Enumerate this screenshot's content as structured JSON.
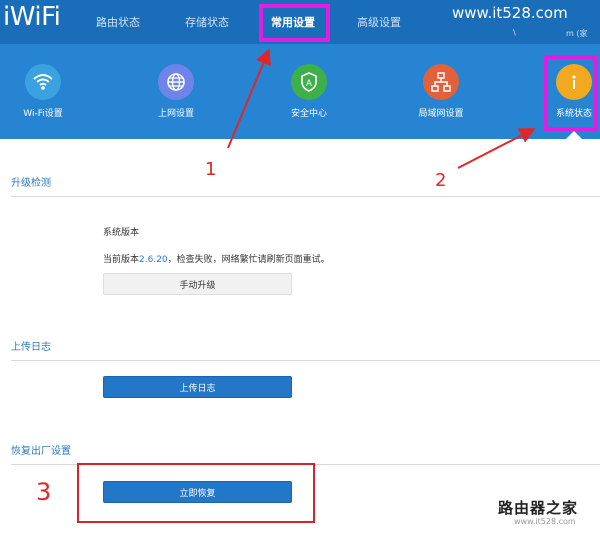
{
  "header": {
    "logo": "iWiFi",
    "tabs": [
      {
        "label": "路由状态"
      },
      {
        "label": "存储状态"
      },
      {
        "label": "常用设置"
      },
      {
        "label": "高级设置"
      }
    ],
    "watermark": "www.it528.com",
    "tiny_left": "\\",
    "tiny_right": "m (家"
  },
  "icons": [
    {
      "label": "Wi-Fi设置",
      "icon": "wifi-icon",
      "color": "#3aa2e0"
    },
    {
      "label": "上网设置",
      "icon": "globe-icon",
      "color": "#6e84e8"
    },
    {
      "label": "安全中心",
      "icon": "shield-icon",
      "color": "#3db04a"
    },
    {
      "label": "局域网设置",
      "icon": "network-icon",
      "color": "#e2613a"
    },
    {
      "label": "系统状态",
      "icon": "info-icon",
      "color": "#f2a91f"
    }
  ],
  "upgrade": {
    "title": "升级检测",
    "version_heading": "系统版本",
    "status_prefix": "当前版本",
    "version": "2.6.20",
    "status_suffix": "，检查失败，网络繁忙请刷新页面重试。",
    "button": "手动升级"
  },
  "log": {
    "title": "上传日志",
    "button": "上传日志"
  },
  "reset": {
    "title": "恢复出厂设置",
    "button": "立即恢复"
  },
  "annotations": {
    "n1": "1",
    "n2": "2",
    "n3": "3"
  },
  "corner_watermark": {
    "main": "路由器之家",
    "sub": "www.it528.com"
  },
  "colors": {
    "topbar": "#1a6eb9",
    "iconbar": "#2684d2",
    "highlight": "#e21ce0",
    "annotation": "#e0262a",
    "primary_button": "#2277c9",
    "section_title": "#2d7bc6"
  }
}
